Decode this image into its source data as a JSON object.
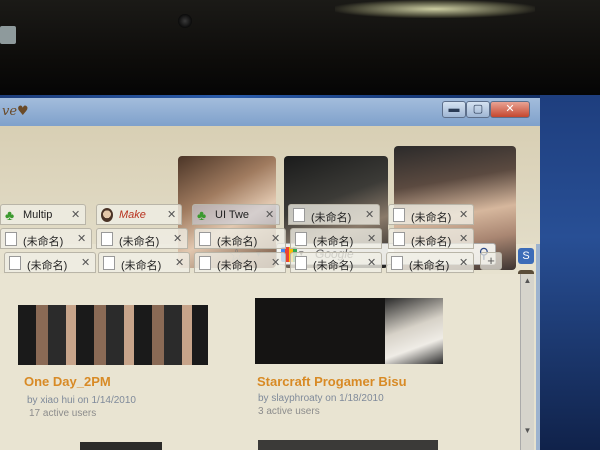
{
  "window": {
    "logo_text": "ve♥"
  },
  "controls": {
    "minimize": "▬",
    "maximize": "▢",
    "close": "✕"
  },
  "toolbar": {
    "search_placeholder": "Google",
    "icons": [
      "star-icon",
      "google-icon",
      "search-icon"
    ]
  },
  "tabs": {
    "row1": [
      {
        "label": "Multip",
        "icon": "clover-icon"
      },
      {
        "label": "Make ",
        "icon": "face-icon"
      },
      {
        "label": "UI Twe",
        "icon": "clover-icon"
      },
      {
        "label": "(未命名)",
        "icon": "page-icon"
      },
      {
        "label": "(未命名)",
        "icon": "page-icon"
      }
    ],
    "row2": [
      {
        "label": "(未命名)"
      },
      {
        "label": "(未命名)"
      },
      {
        "label": "(未命名)"
      },
      {
        "label": "(未命名)"
      },
      {
        "label": "(未命名)"
      }
    ],
    "row3": [
      {
        "label": "(未命名)"
      },
      {
        "label": "(未命名)"
      },
      {
        "label": "(未命名)"
      },
      {
        "label": "(未命名)"
      },
      {
        "label": "(未命名)"
      }
    ],
    "close_glyph": "✕",
    "new_tab_glyph": "+"
  },
  "cards": [
    {
      "title": "One Day_2PM",
      "meta": "by xiao hui on 1/14/2010",
      "users": "17 active users"
    },
    {
      "title": "Starcraft Progamer Bisu",
      "meta": "by slayphroaty on 1/18/2010",
      "users": "3 active users"
    }
  ]
}
